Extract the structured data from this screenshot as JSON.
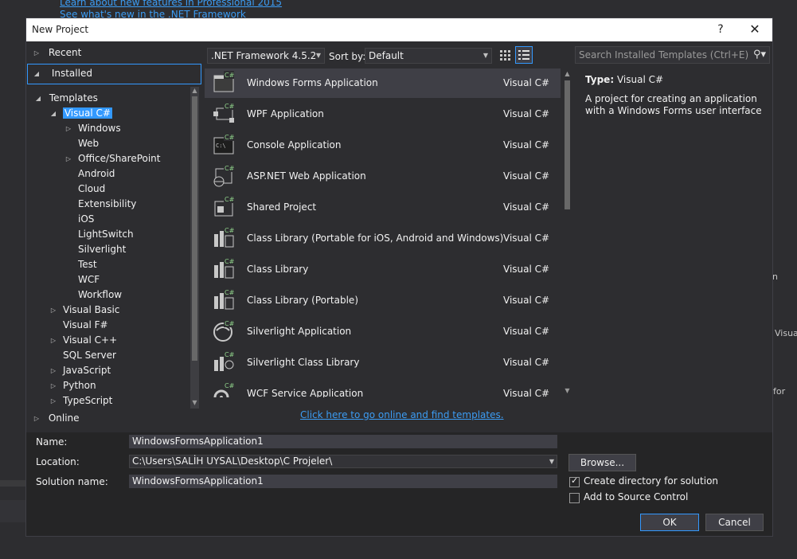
{
  "background": {
    "link1": "Learn about new features in Professional 2015",
    "link2": "See what's new in the .NET Framework",
    "frag1": "n",
    "frag2": "Visua",
    "frag3": "for"
  },
  "dialog": {
    "title": "New Project",
    "help": "?",
    "close": "✕"
  },
  "nav": {
    "recent": "Recent",
    "installed": "Installed",
    "online": "Online"
  },
  "tree": {
    "templates": "Templates",
    "visual_csharp": "Visual C#",
    "children": [
      "Windows",
      "Web",
      "Office/SharePoint",
      "Android",
      "Cloud",
      "Extensibility",
      "iOS",
      "LightSwitch",
      "Silverlight",
      "Test",
      "WCF",
      "Workflow"
    ],
    "others": [
      "Visual Basic",
      "Visual F#",
      "Visual C++",
      "SQL Server",
      "JavaScript",
      "Python",
      "TypeScript"
    ]
  },
  "toolbar": {
    "framework": ".NET Framework 4.5.2",
    "sort_label": "Sort by:",
    "sort_value": "Default",
    "search_placeholder": "Search Installed Templates (Ctrl+E)"
  },
  "templates": [
    {
      "name": "Windows Forms Application",
      "lang": "Visual C#",
      "icon": "windows-forms-icon"
    },
    {
      "name": "WPF Application",
      "lang": "Visual C#",
      "icon": "wpf-icon"
    },
    {
      "name": "Console Application",
      "lang": "Visual C#",
      "icon": "console-icon"
    },
    {
      "name": "ASP.NET Web Application",
      "lang": "Visual C#",
      "icon": "web-app-icon"
    },
    {
      "name": "Shared Project",
      "lang": "Visual C#",
      "icon": "shared-project-icon"
    },
    {
      "name": "Class Library (Portable for iOS, Android and Windows)",
      "lang": "Visual C#",
      "icon": "class-library-icon"
    },
    {
      "name": "Class Library",
      "lang": "Visual C#",
      "icon": "class-library-icon"
    },
    {
      "name": "Class Library (Portable)",
      "lang": "Visual C#",
      "icon": "class-library-icon"
    },
    {
      "name": "Silverlight Application",
      "lang": "Visual C#",
      "icon": "silverlight-icon"
    },
    {
      "name": "Silverlight Class Library",
      "lang": "Visual C#",
      "icon": "silverlight-library-icon"
    },
    {
      "name": "WCF Service Application",
      "lang": "Visual C#",
      "icon": "wcf-icon"
    }
  ],
  "online_link": "Click here to go online and find templates.",
  "details": {
    "type_label": "Type:",
    "type_value": "Visual C#",
    "description": "A project for creating an application with a Windows Forms user interface"
  },
  "form": {
    "name_label": "Name:",
    "name_value": "WindowsFormsApplication1",
    "location_label": "Location:",
    "location_value": "C:\\Users\\SALİH UYSAL\\Desktop\\C Projeler\\",
    "solution_label": "Solution name:",
    "solution_value": "WindowsFormsApplication1",
    "browse": "Browse...",
    "create_dir": "Create directory for solution",
    "source_control": "Add to Source Control",
    "ok": "OK",
    "cancel": "Cancel"
  }
}
